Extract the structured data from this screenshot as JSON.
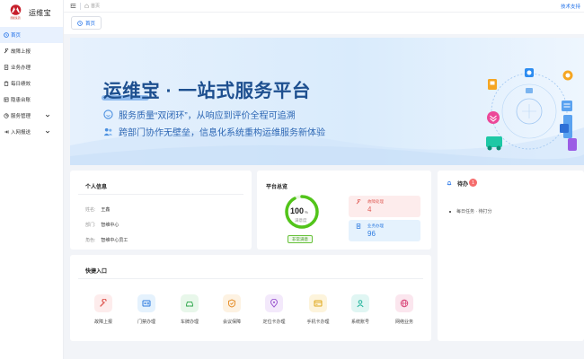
{
  "brand": {
    "logo_sub": "国能集团",
    "name": "运维宝"
  },
  "sidebar": {
    "items": [
      {
        "label": "首页",
        "icon": "home-icon"
      },
      {
        "label": "故障上报",
        "icon": "wrench-icon"
      },
      {
        "label": "业务办理",
        "icon": "document-icon"
      },
      {
        "label": "每日绩效",
        "icon": "clipboard-icon"
      },
      {
        "label": "隐患台账",
        "icon": "ledger-icon"
      },
      {
        "label": "服务管理",
        "icon": "service-icon"
      },
      {
        "label": "入网报送",
        "icon": "network-icon"
      }
    ]
  },
  "topbar": {
    "breadcrumb": "首页",
    "support": "技术支持"
  },
  "tabs": [
    {
      "label": "首页"
    }
  ],
  "banner": {
    "title": "运维宝 · 一站式服务平台",
    "line1": "服务质量“双闭环”，从响应到评价全程可追溯",
    "line2": "跨部门协作无壁垒，信息化系统重构运维服务新体验"
  },
  "personal": {
    "title": "个人信息",
    "rows": [
      {
        "label": "姓名:",
        "value": "王鑫"
      },
      {
        "label": "部门:",
        "value": "智维中心"
      },
      {
        "label": "角色:",
        "value": "智维中心员工"
      }
    ]
  },
  "platform": {
    "title": "平台总览",
    "satisfaction": {
      "value": "100",
      "unit": "%",
      "label": "满意度",
      "badge": "非常满意",
      "percent": 100
    },
    "stats": [
      {
        "label": "故障处理",
        "value": "4"
      },
      {
        "label": "业务办理",
        "value": "96"
      }
    ]
  },
  "todo": {
    "title": "待办",
    "count": "1",
    "items": [
      "每日任务 · 待打分"
    ]
  },
  "quick": {
    "title": "快捷入口",
    "items": [
      {
        "label": "故障上报",
        "icon": "wrench-icon"
      },
      {
        "label": "门禁办理",
        "icon": "id-card-icon"
      },
      {
        "label": "车牌办理",
        "icon": "car-icon"
      },
      {
        "label": "会议保障",
        "icon": "shield-icon"
      },
      {
        "label": "定位卡办理",
        "icon": "location-icon"
      },
      {
        "label": "手机卡办理",
        "icon": "sim-card-icon"
      },
      {
        "label": "系统账号",
        "icon": "user-icon"
      },
      {
        "label": "网络业务",
        "icon": "globe-icon"
      }
    ]
  },
  "colors": {
    "primary": "#1e6fe8",
    "banner_title": "#1d4f8f",
    "success": "#52c41a",
    "danger": "#f56c6c"
  }
}
